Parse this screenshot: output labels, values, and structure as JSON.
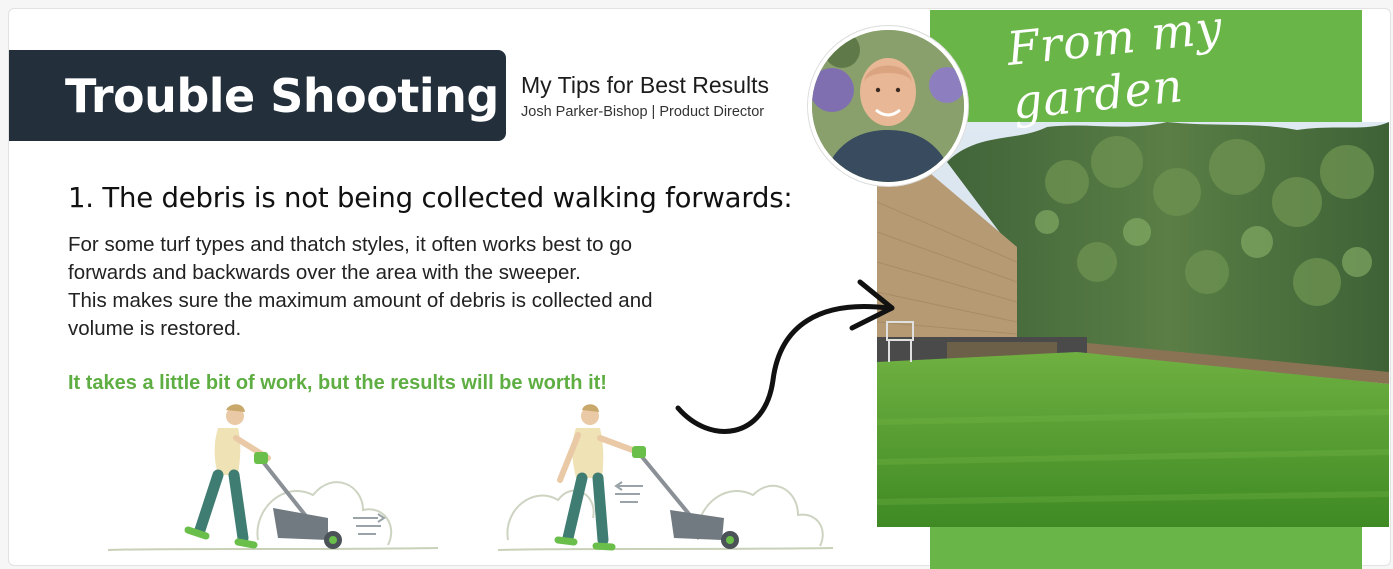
{
  "header": {
    "title": "Trouble Shooting",
    "tips_title": "My Tips for Best Results",
    "author_line": "Josh Parker-Bishop | Product Director",
    "script_label": "From my garden"
  },
  "section": {
    "heading": "1. The debris is not being collected walking forwards:",
    "body_lines": [
      "For some turf types and thatch styles, it often works best to go",
      "forwards and backwards over the area with the sweeper.",
      "This makes sure the maximum amount of debris is collected and",
      "volume is restored."
    ],
    "highlight": "It takes a little bit of work, but the results will be worth it!"
  },
  "colors": {
    "brand_green": "#6ab547",
    "highlight_green": "#5fae43",
    "navy": "#23303c"
  },
  "icons": {
    "arrow": "curved-arrow-icon",
    "illustration_forward": "man-pushing-sweeper",
    "illustration_backward": "man-pulling-sweeper"
  }
}
